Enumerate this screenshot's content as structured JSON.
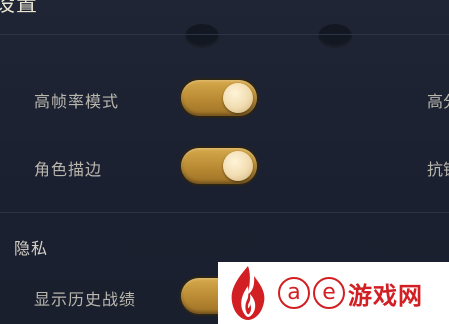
{
  "panel": {
    "title": "设置"
  },
  "settings": {
    "high_frame_rate": {
      "label": "高帧率模式",
      "enabled": true
    },
    "character_outline": {
      "label": "角色描边",
      "enabled": true
    }
  },
  "right_column": {
    "label_1": "高分",
    "label_2": "抗锯"
  },
  "privacy": {
    "title": "隐私",
    "show_history": {
      "label": "显示历史战绩",
      "enabled": true
    }
  },
  "watermark": {
    "circle_1": "a",
    "circle_2": "e",
    "site_name": "游戏网"
  },
  "colors": {
    "toggle_on": "#c9993c",
    "background": "#1c2231",
    "watermark_red": "#d21f23"
  }
}
